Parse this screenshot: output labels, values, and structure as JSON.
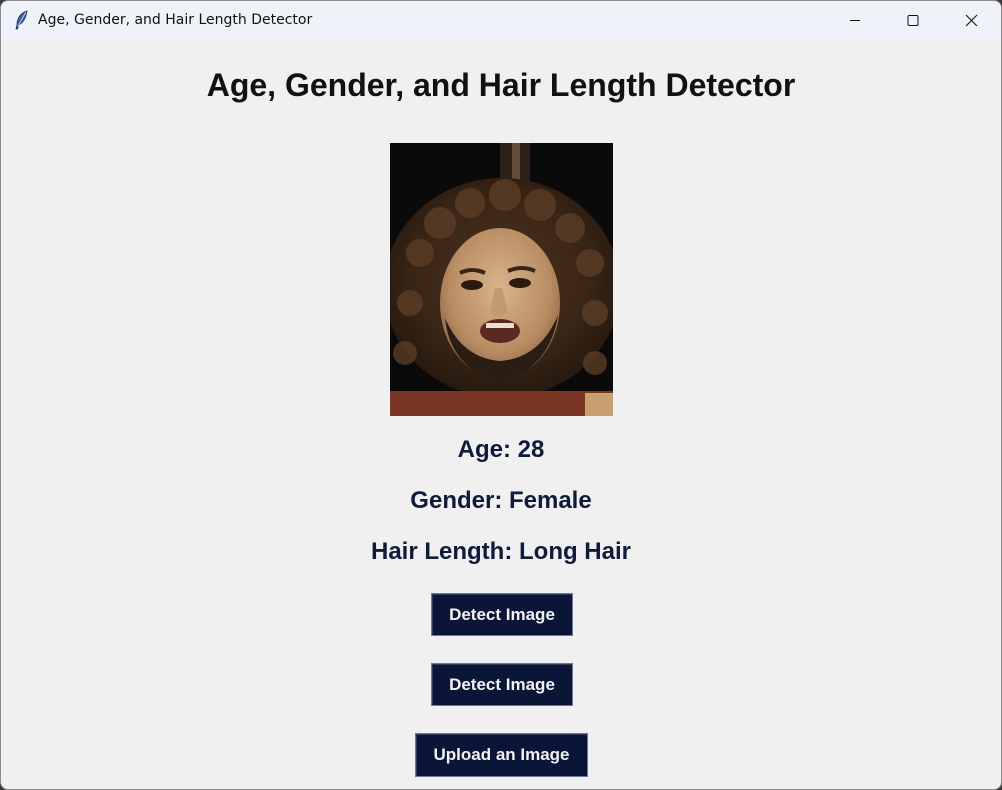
{
  "window": {
    "title": "Age, Gender, and Hair Length Detector",
    "icon": "feather-icon",
    "controls": [
      "minimize-icon",
      "maximize-icon",
      "close-icon"
    ]
  },
  "main": {
    "heading": "Age, Gender, and Hair Length Detector",
    "image": {
      "description_icon": "uploaded-face-photo"
    },
    "results": {
      "age": "Age: 28",
      "gender": "Gender: Female",
      "hair_length": "Hair Length: Long Hair"
    },
    "buttons": {
      "detect_1": "Detect Image",
      "detect_2": "Detect Image",
      "upload": "Upload an Image"
    }
  },
  "colors": {
    "window_bg": "#f0f0f0",
    "titlebar_bg": "#eff2f9",
    "button_bg": "#0a1538",
    "button_text": "#f2f2f2",
    "result_text": "#0f1b3a"
  }
}
